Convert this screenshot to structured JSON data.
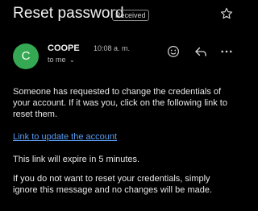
{
  "email": {
    "subject": "Reset password",
    "label": "Received",
    "sender": {
      "initial": "C",
      "name": "COOPE",
      "time": "10:08 a. m.",
      "recipient": "to me"
    },
    "body": {
      "p1": "Someone has requested to change the credentials of your account. If it was you, click on the following link to reset them.",
      "link": "Link to update the account",
      "p2": "This link will expire in 5 minutes.",
      "p3": "If you do not want to reset your credentials, simply ignore this message and no changes will be made."
    }
  },
  "icons": [
    "star-icon",
    "emoji-icon",
    "reply-icon",
    "more-icon",
    "chevron-down-icon"
  ],
  "colors": {
    "background": "#000000",
    "avatar": "#34a853",
    "link": "#5a9bf0"
  }
}
